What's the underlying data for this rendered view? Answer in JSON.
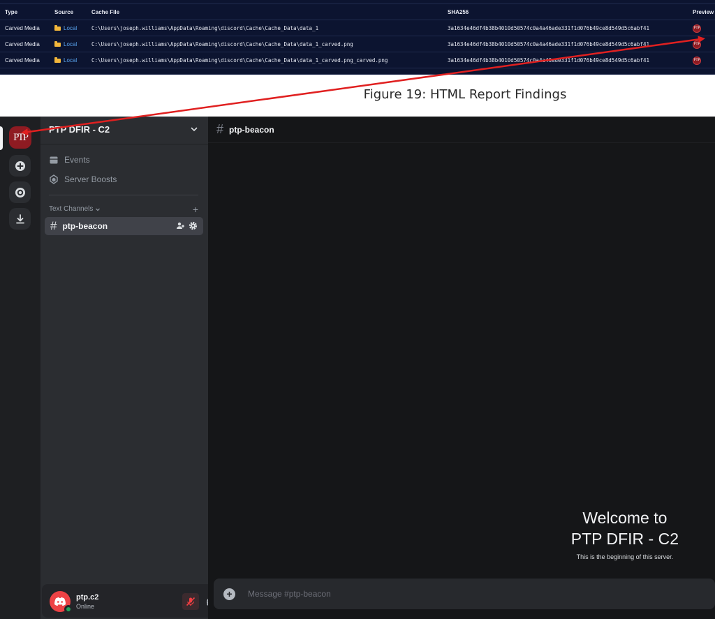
{
  "report": {
    "headers": {
      "type": "Type",
      "source": "Source",
      "file": "Cache File",
      "sha": "SHA256",
      "preview": "Preview"
    },
    "rows": [
      {
        "type": "Carved Media",
        "source": "Local",
        "file": "C:\\Users\\joseph.williams\\AppData\\Roaming\\discord\\Cache\\Cache_Data\\data_1",
        "sha": "3a1634e46df4b38b4010d50574c0a4a46ade331f1d076b49ce8d549d5c6abf41"
      },
      {
        "type": "Carved Media",
        "source": "Local",
        "file": "C:\\Users\\joseph.williams\\AppData\\Roaming\\discord\\Cache\\Cache_Data\\data_1_carved.png",
        "sha": "3a1634e46df4b38b4010d50574c0a4a46ade331f1d076b49ce8d549d5c6abf41"
      },
      {
        "type": "Carved Media",
        "source": "Local",
        "file": "C:\\Users\\joseph.williams\\AppData\\Roaming\\discord\\Cache\\Cache_Data\\data_1_carved.png_carved.png",
        "sha": "3a1634e46df4b38b4010d50574c0a4a46ade331f1d076b49ce8d549d5c6abf41"
      }
    ],
    "preview_glyph": "PTP"
  },
  "caption": "Figure 19: HTML Report Findings",
  "discord": {
    "server_icon_text": "PTP",
    "server_name": "PTP DFIR - C2",
    "events_label": "Events",
    "boosts_label": "Server Boosts",
    "category_label": "Text Channels",
    "channel_name": "ptp-beacon",
    "header_channel": "ptp-beacon",
    "user": {
      "name": "ptp.c2",
      "status": "Online"
    },
    "welcome": {
      "line1": "Welcome to",
      "line2": "PTP DFIR - C2",
      "sub": "This is the beginning of this server."
    },
    "composer_placeholder": "Message #ptp-beacon"
  },
  "colors": {
    "accent_red": "#8f1b22",
    "online": "#23a55a",
    "arrow": "#e02020"
  }
}
